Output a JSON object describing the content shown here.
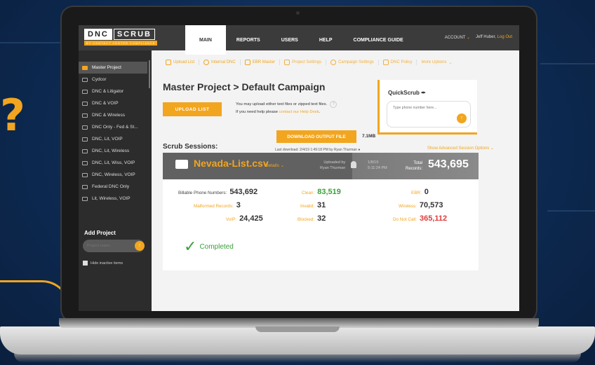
{
  "brand": {
    "logo_dnc": "DNC",
    "logo_scrub": "SCRUB",
    "logo_sub": "BY CONTACT CENTER COMPLIANCE"
  },
  "nav": {
    "tabs": [
      "MAIN",
      "REPORTS",
      "USERS",
      "HELP",
      "COMPLIANCE GUIDE"
    ],
    "active": "MAIN"
  },
  "account": {
    "label": "ACCOUNT",
    "user": "Jeff Huber,",
    "logout": "Log Out"
  },
  "sidebar": {
    "items": [
      "Master Project",
      "Cydcor",
      "DNC & Litigator",
      "DNC & VOIP",
      "DNC & Wireless",
      "DNC Only - Fed & St...",
      "DNC, Lit, VOIP",
      "DNC, Lit, Wireless",
      "DNC, Lit, Wiss, VOIP",
      "DNC, Wireless, VOIP",
      "Federal DNC Only",
      "Lit, Wireless, VOIP"
    ],
    "active": "Master Project",
    "add_project_title": "Add Project",
    "project_placeholder": "Project name...",
    "hide_inactive": "Hide inactive items"
  },
  "toolbar": [
    "Upload List",
    "Internal DNC",
    "EBR Master",
    "Project Settings",
    "Campaign Settings",
    "DNC Policy",
    "More Options"
  ],
  "main": {
    "title": "Master Project > Default Campaign",
    "upload_button": "UPLOAD LIST",
    "upload_info_line1": "You may upload either text files or zipped text files.",
    "upload_info_line2a": "If you need help please ",
    "upload_info_link": "contact our Help Desk",
    "upload_info_line2b": ".",
    "help_glyph": "?"
  },
  "quickscrub": {
    "title": "QuickScrub",
    "placeholder": "Type phone number here..."
  },
  "sessions": {
    "title": "Scrub Sessions:",
    "advanced": "Show Advanced Session Options",
    "file_name": "Nevada-List.csv",
    "details": "Details",
    "uploaded_by_label": "Uploaded by",
    "uploaded_by": "Ryan Thurman",
    "date": "1/8/19",
    "time": "5:11:24 PM",
    "total_label1": "Total",
    "total_label2": "Records:",
    "total_value": "543,695",
    "stats": {
      "billable_label": "Billable Phone Numbers:",
      "billable": "543,692",
      "malformed_label": "Malformed Records:",
      "malformed": "3",
      "voip_label": "VoIP:",
      "voip": "24,425",
      "clean_label": "Clean:",
      "clean": "83,519",
      "invalid_label": "Invalid:",
      "invalid": "31",
      "blocked_label": "Blocked:",
      "blocked": "32",
      "ebr_label": "EBR:",
      "ebr": "0",
      "wireless_label": "Wireless:",
      "wireless": "70,573",
      "dnc_label": "Do Not Call:",
      "dnc": "365,112"
    },
    "status": "Completed",
    "download_button": "DOWNLOAD OUTPUT FILE",
    "file_size": "7.1MB",
    "last_download": "Last download: 2/4/19 1:49:18 PM by Ryan Thurman"
  },
  "colors": {
    "accent": "#f2a51e",
    "clean": "#3aa13a",
    "dnc": "#e03a3a"
  }
}
